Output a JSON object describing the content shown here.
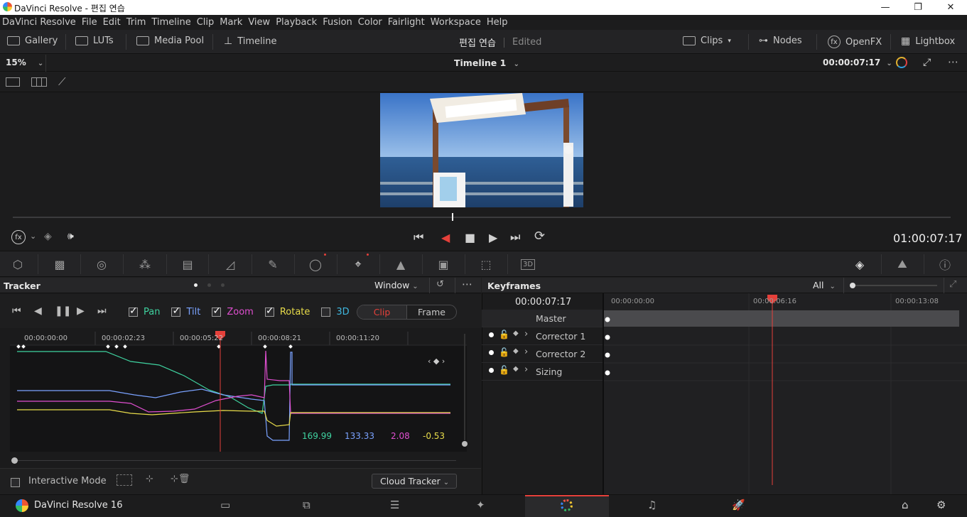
{
  "window": {
    "title": "DaVinci Resolve - 편집 연습"
  },
  "menu": [
    "DaVinci Resolve",
    "File",
    "Edit",
    "Trim",
    "Timeline",
    "Clip",
    "Mark",
    "View",
    "Playback",
    "Fusion",
    "Color",
    "Fairlight",
    "Workspace",
    "Help"
  ],
  "toolbar": {
    "gallery": "Gallery",
    "luts": "LUTs",
    "media_pool": "Media Pool",
    "timeline": "Timeline",
    "project": "편집 연습",
    "status": "Edited",
    "clips": "Clips",
    "nodes": "Nodes",
    "openfx": "OpenFX",
    "lightbox": "Lightbox"
  },
  "viewer": {
    "zoom": "15%",
    "timeline_name": "Timeline 1",
    "timecode": "00:00:07:17",
    "playhead_tc": "01:00:07:17"
  },
  "tracker": {
    "title": "Tracker",
    "mode": "Window",
    "options": [
      {
        "label": "Pan",
        "checked": true,
        "color": "#3fd3a0"
      },
      {
        "label": "Tilt",
        "checked": true,
        "color": "#7aa2ff"
      },
      {
        "label": "Zoom",
        "checked": true,
        "color": "#e04fd0"
      },
      {
        "label": "Rotate",
        "checked": true,
        "color": "#e8dc4a"
      },
      {
        "label": "3D",
        "checked": false,
        "color": "#3fb8e0"
      }
    ],
    "clip_label": "Clip",
    "frame_label": "Frame",
    "ruler": [
      "00:00:00:00",
      "00:00:02:23",
      "00:00:05:22",
      "00:00:08:21",
      "00:00:11:20"
    ],
    "values": {
      "pan": "169.99",
      "tilt": "133.33",
      "zoom": "2.08",
      "rotate": "-0.53"
    },
    "interactive_mode": "Interactive Mode",
    "cloud_tracker": "Cloud Tracker"
  },
  "keyframes": {
    "title": "Keyframes",
    "filter": "All",
    "timecode": "00:00:07:17",
    "ruler": [
      "00:00:00:00",
      "00:00:06:16",
      "00:00:13:08"
    ],
    "rows": [
      "Master",
      "Corrector 1",
      "Corrector 2",
      "Sizing"
    ]
  },
  "bottom": {
    "app": "DaVinci Resolve 16"
  },
  "colors": {
    "playhead": "#e5403a",
    "accent_red": "#e5403a"
  }
}
